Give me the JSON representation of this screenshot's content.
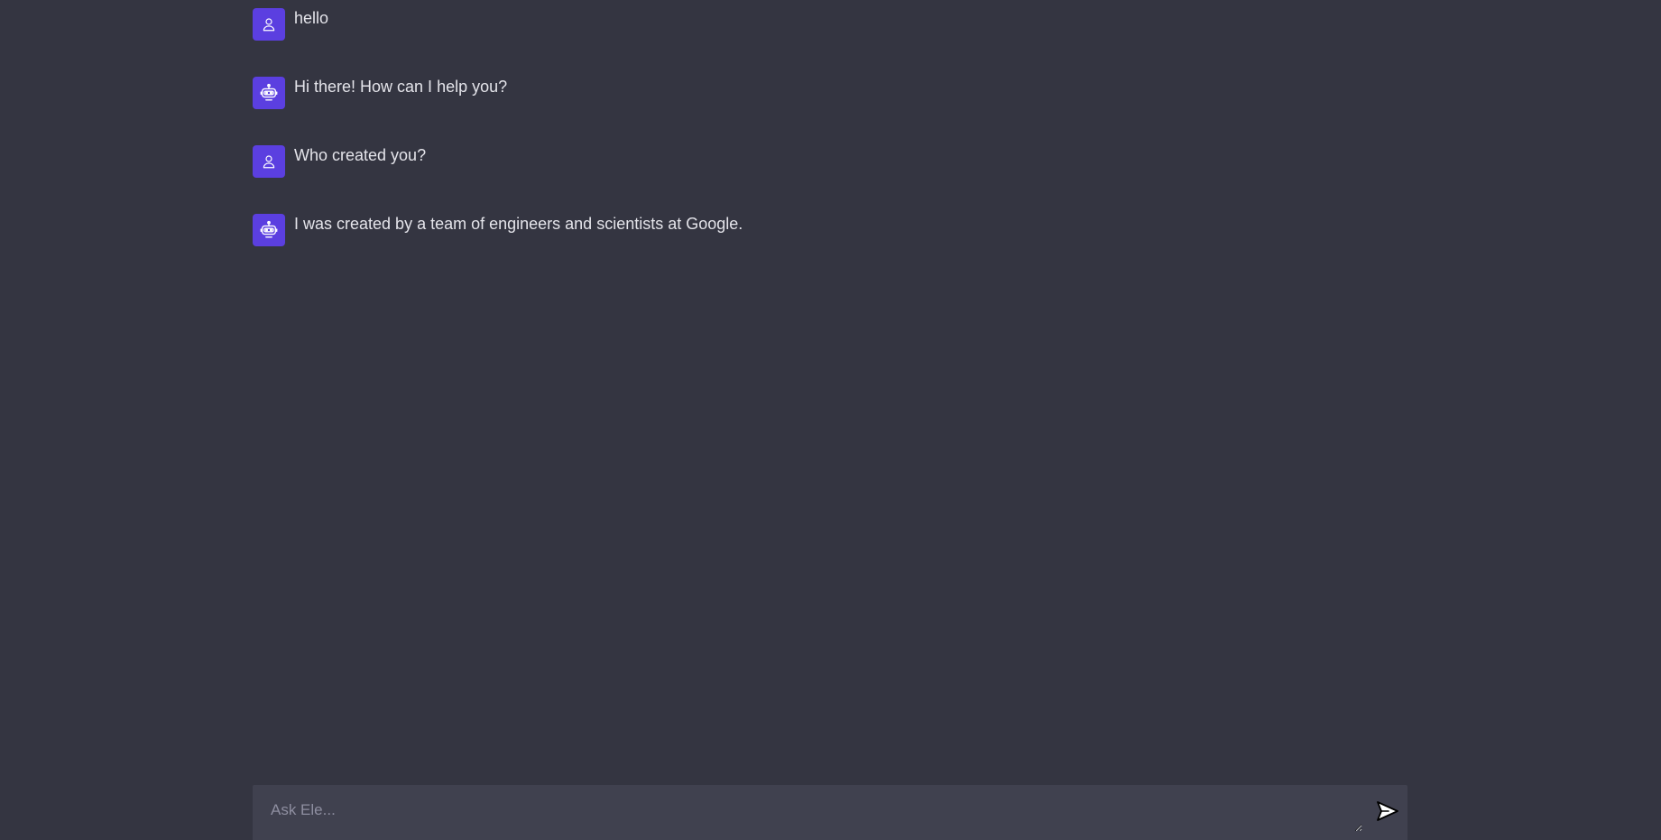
{
  "colors": {
    "background": "#343541",
    "avatar": "#5b3fe0",
    "composer": "#40414f",
    "text": "#e4e4ea",
    "placeholder": "#8e8ea0"
  },
  "messages": [
    {
      "role": "user",
      "icon": "user-icon",
      "text": "hello"
    },
    {
      "role": "bot",
      "icon": "robot-icon",
      "text": "Hi there! How can I help you?"
    },
    {
      "role": "user",
      "icon": "user-icon",
      "text": "Who created you?"
    },
    {
      "role": "bot",
      "icon": "robot-icon",
      "text": "I was created by a team of engineers and scientists at Google."
    }
  ],
  "composer": {
    "placeholder": "Ask Ele...",
    "value": "",
    "send_icon": "send-icon"
  }
}
